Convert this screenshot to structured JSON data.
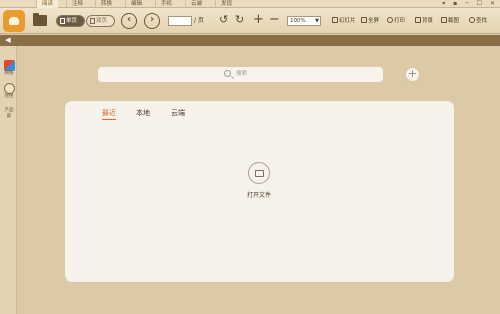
{
  "tabs": [
    "阅读",
    "注释",
    "转换",
    "编辑",
    "手机",
    "云端",
    "发现"
  ],
  "window_controls": "▾ ▪ ─ ☐ ✕",
  "toolbar": {
    "single_page": "单页",
    "double_page": "双页",
    "page_separator": "/ 页",
    "zoom_value": "100%",
    "slideshow": "幻灯片",
    "fullscreen": "全屏",
    "print": "打印",
    "background": "背景",
    "screenshot": "截图",
    "search": "查找"
  },
  "rail": [
    {
      "label": "网络",
      "icon": "tw-icon"
    },
    {
      "label": "财经",
      "icon": "finance-icon"
    },
    {
      "label": "产品部",
      "icon": "product-icon"
    }
  ],
  "search": {
    "placeholder": "搜索"
  },
  "panel": {
    "tabs": [
      "最近",
      "本地",
      "云端"
    ],
    "active_tab": "最近",
    "open_file_label": "打开文件"
  },
  "colors": {
    "accent": "#e06a1f",
    "darkbar": "#8a6e45",
    "background": "#dcc9a6"
  }
}
